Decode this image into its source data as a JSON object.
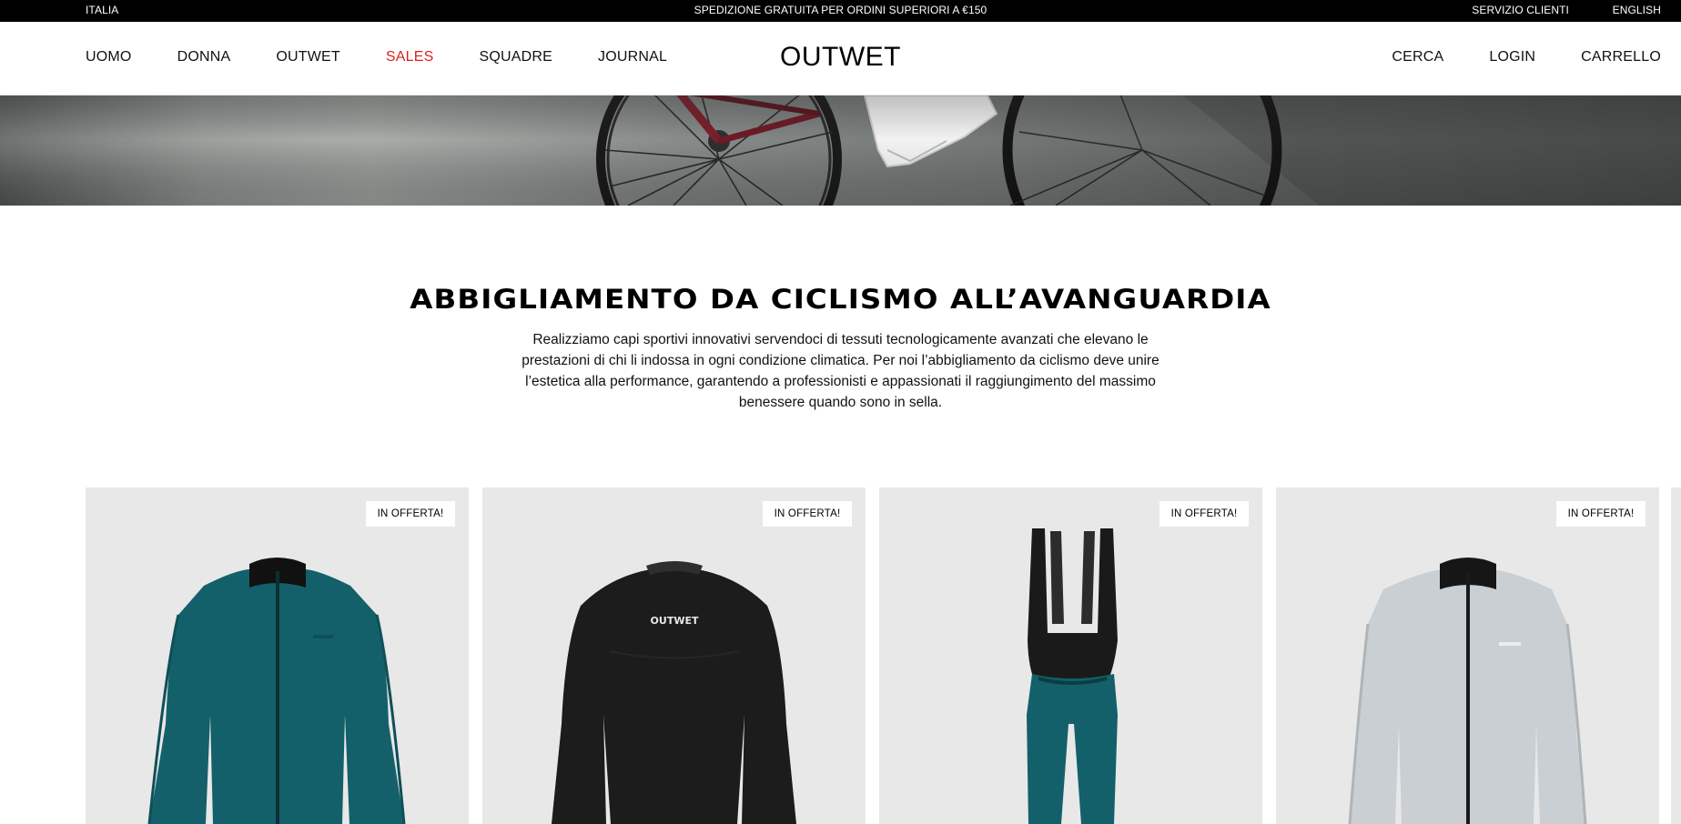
{
  "topbar": {
    "country": "ITALIA",
    "promo": "SPEDIZIONE GRATUITA PER ORDINI SUPERIORI A €150",
    "service": "SERVIZIO CLIENTI",
    "language": "ENGLISH"
  },
  "header": {
    "logo": "OUTWET",
    "nav": [
      {
        "label": "UOMO"
      },
      {
        "label": "DONNA"
      },
      {
        "label": "OUTWET"
      },
      {
        "label": "SALES"
      },
      {
        "label": "SQUADRE"
      },
      {
        "label": "JOURNAL"
      }
    ],
    "actions": {
      "search": "CERCA",
      "login": "LOGIN",
      "cart": "CARRELLO"
    }
  },
  "colors": {
    "sales_accent": "#e01f1f",
    "card_bg": "#e8e8e8",
    "teal_product": "#13606a"
  },
  "intro": {
    "title": "ABBIGLIAMENTO DA CICLISMO ALL’AVANGUARDIA",
    "text": "Realizziamo capi sportivi innovativi servendoci di tessuti tecnologicamente avanzati che elevano le prestazioni di chi li indossa in ogni condizione climatica. Per noi l’abbigliamento da ciclismo deve unire l’estetica alla performance, garantendo a professionisti e appassionati il raggiungimento del massimo benessere quando sono in sella."
  },
  "products": [
    {
      "badge": "IN OFFERTA!",
      "image": "teal-jacket"
    },
    {
      "badge": "IN OFFERTA!",
      "image": "black-base-layer",
      "print": "OUTWET"
    },
    {
      "badge": "IN OFFERTA!",
      "image": "teal-bib-tights"
    },
    {
      "badge": "IN OFFERTA!",
      "image": "silver-jacket"
    }
  ]
}
